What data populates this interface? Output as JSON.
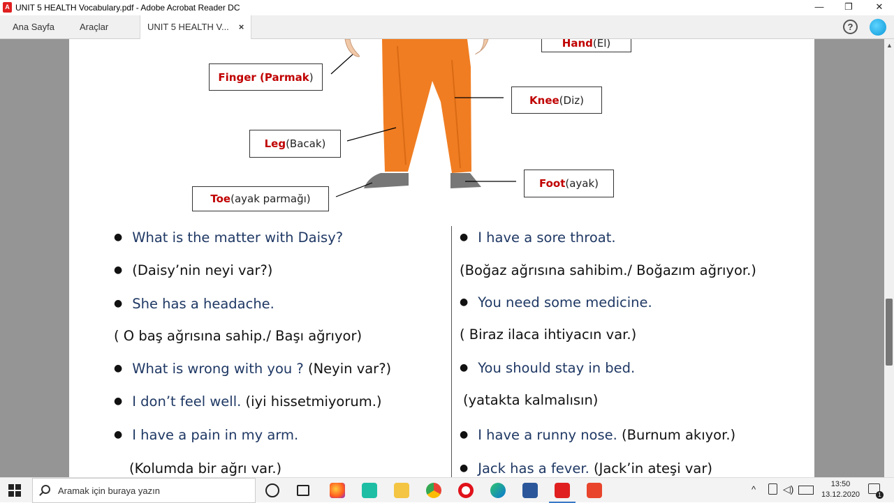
{
  "window": {
    "title": "UNIT 5 HEALTH  Vocabulary.pdf - Adobe Acrobat Reader DC",
    "controls": {
      "minimize": "—",
      "restore": "❐",
      "close": "✕"
    }
  },
  "tabs": {
    "home": "Ana Sayfa",
    "tools": "Araçlar",
    "document": "UNIT 5 HEALTH   V...",
    "document_close": "×",
    "help": "?"
  },
  "labels": {
    "hand": {
      "en": "Hand",
      "tr": " (El)"
    },
    "finger": {
      "en": "Finger  (Parmak",
      "tr": ")"
    },
    "knee": {
      "en": "Knee",
      "tr": " (Diz)"
    },
    "leg": {
      "en": "Leg",
      "tr": " (Bacak)"
    },
    "foot": {
      "en": "Foot",
      "tr": " (ayak)"
    },
    "toe": {
      "en": "Toe",
      "tr": " (ayak parmağı)"
    }
  },
  "left_column": [
    {
      "bullet": true,
      "text": "What is the matter with Daisy?",
      "tr": ""
    },
    {
      "bullet": true,
      "text": "(Daisy’nin neyi var?)",
      "tr": ""
    },
    {
      "bullet": true,
      "text": "She has a headache.",
      "tr": ""
    },
    {
      "bullet": false,
      "text": "",
      "tr": "( O baş ağrısına sahip./ Başı ağrıyor)"
    },
    {
      "bullet": true,
      "text": "What is wrong with you ? ",
      "tr": "(Neyin var?)"
    },
    {
      "bullet": true,
      "text": "I don’t feel well. ",
      "tr": "(iyi hissetmiyorum.)"
    },
    {
      "bullet": true,
      "text": "I have a pain in my arm.",
      "tr": ""
    },
    {
      "bullet": false,
      "text": "",
      "tr": "(Kolumda bir ağrı var.)"
    }
  ],
  "right_column": [
    {
      "bullet": true,
      "text": "I have a sore throat.",
      "tr": ""
    },
    {
      "bullet": false,
      "text": "",
      "tr": "(Boğaz ağrısına sahibim./ Boğazım ağrıyor.)"
    },
    {
      "bullet": true,
      "text": "You need some medicine.",
      "tr": ""
    },
    {
      "bullet": false,
      "text": "( Biraz ilaca ihtiyacın var.)",
      "tr": ""
    },
    {
      "bullet": true,
      "text": "You should stay in bed.",
      "tr": ""
    },
    {
      "bullet": false,
      "text": "",
      "tr": "(yatakta kalmalısın)"
    },
    {
      "bullet": true,
      "text": "I have a runny nose. ",
      "tr": "(Burnum akıyor.)"
    },
    {
      "bullet": true,
      "text": "Jack has a fever. ",
      "tr": "(Jack’in ateşi var)"
    }
  ],
  "taskbar": {
    "search_placeholder": "Aramak için buraya yazın",
    "time": "13:50",
    "date": "13.12.2020",
    "notification_count": "1"
  },
  "colors": {
    "label_red": "#c00000",
    "text_blue": "#1f3864",
    "pants_orange": "#f07d22",
    "viewer_gray": "#959595"
  }
}
